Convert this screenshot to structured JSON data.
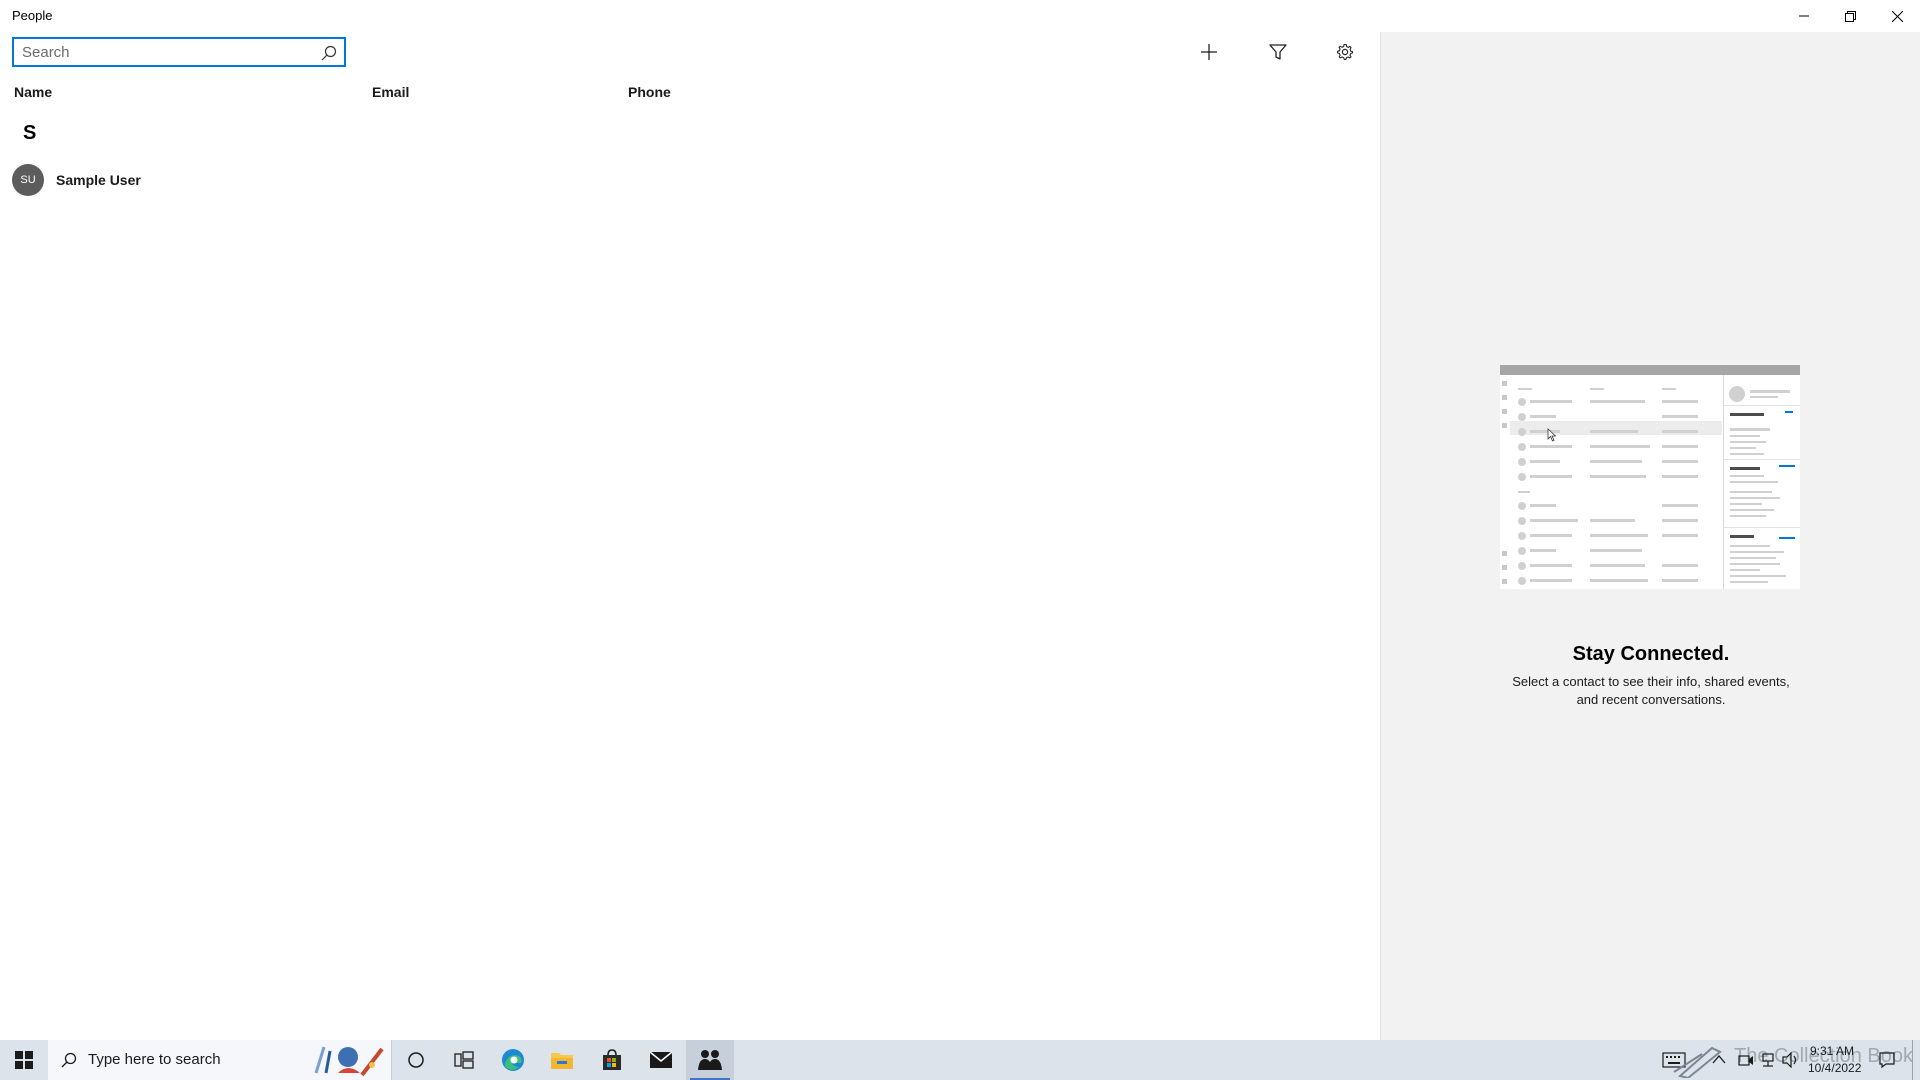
{
  "window": {
    "title": "People",
    "controls": {
      "minimize": "minimize-icon",
      "restore": "restore-icon",
      "close": "close-icon"
    }
  },
  "search": {
    "placeholder": "Search",
    "value": ""
  },
  "toolbar": {
    "add_icon": "plus-icon",
    "filter_icon": "filter-icon",
    "settings_icon": "gear-icon"
  },
  "list": {
    "columns": [
      "Name",
      "Email",
      "Phone"
    ],
    "groups": [
      {
        "letter": "S",
        "contacts": [
          {
            "initials": "SU",
            "name": "Sample User",
            "email": "",
            "phone": ""
          }
        ]
      }
    ]
  },
  "detail": {
    "title": "Stay Connected.",
    "body_line1": "Select a contact to see their info, shared events,",
    "body_line2": "and recent conversations."
  },
  "taskbar": {
    "search_placeholder": "Type here to search",
    "pinned": [
      "cortana-icon",
      "task-view-icon",
      "edge-icon",
      "file-explorer-icon",
      "store-icon",
      "mail-icon",
      "people-icon"
    ],
    "active": "people-icon",
    "clock_time": "9:31 AM",
    "clock_date": "10/4/2022"
  },
  "colors": {
    "accent": "#0078d7",
    "detail_bg": "#f2f2f2",
    "taskbar_bg": "#dde3ea",
    "avatar_bg": "#5c5c5c"
  }
}
